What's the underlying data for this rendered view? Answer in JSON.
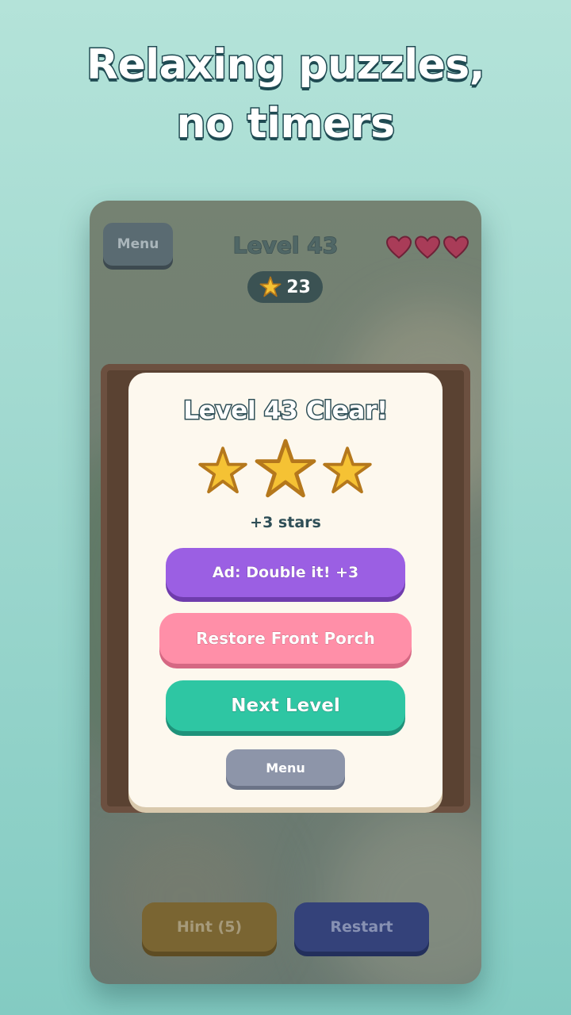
{
  "headline": {
    "line1": "Relaxing puzzles,",
    "line2": "no timers"
  },
  "hud": {
    "menu_label": "Menu",
    "level_title": "Level 43",
    "lives": 3,
    "star_count": "23",
    "heart_color": "#b8435f"
  },
  "modal": {
    "title": "Level 43 Clear!",
    "stars_earned": 3,
    "stars_label": "+3 stars",
    "ad_button": "Ad: Double it! +3",
    "restore_button": "Restore Front Porch",
    "next_button": "Next Level",
    "menu_button": "Menu"
  },
  "bottom": {
    "hint_label": "Hint (5)",
    "restart_label": "Restart"
  },
  "colors": {
    "star_fill": "#f5c234",
    "star_outline": "#b5781c",
    "ad_purple": "#9b5fe3",
    "restore_pink": "#ff8fa8",
    "next_green": "#2ec6a3"
  }
}
